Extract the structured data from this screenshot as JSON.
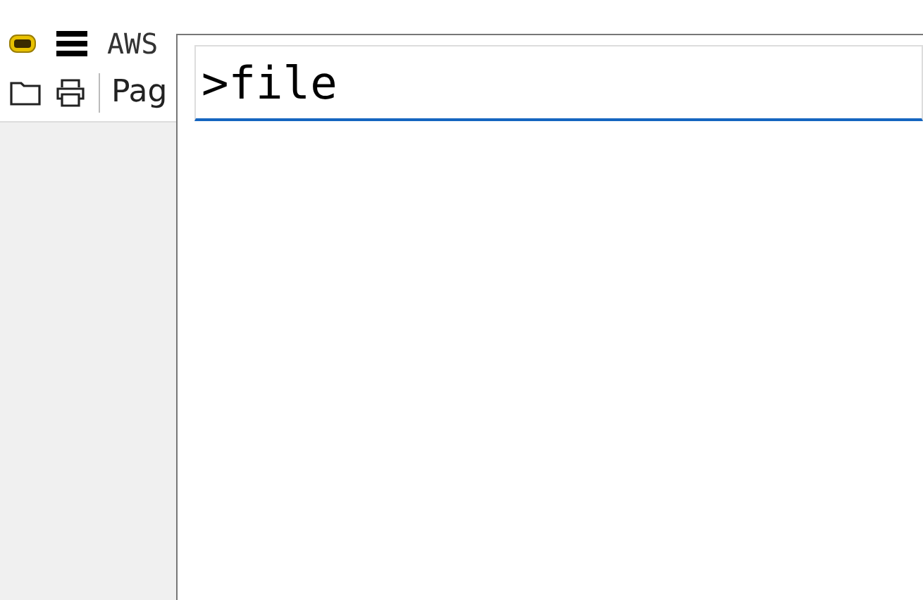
{
  "title": "AWS",
  "toolbar": {
    "page_label": "Pag"
  },
  "command_palette": {
    "value": ">file"
  }
}
